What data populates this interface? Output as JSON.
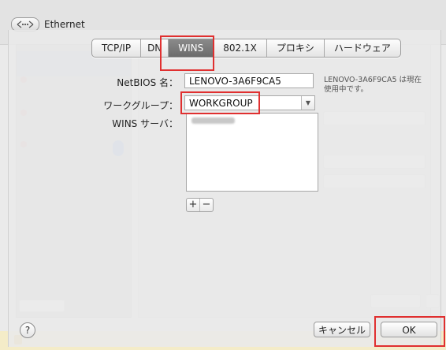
{
  "window": {
    "title": "Ethernet"
  },
  "tabs": [
    {
      "label": "TCP/IP"
    },
    {
      "label": "DN"
    },
    {
      "label": "WINS"
    },
    {
      "label": "802.1X"
    },
    {
      "label": "プロキシ"
    },
    {
      "label": "ハードウェア"
    }
  ],
  "active_tab": "WINS",
  "form": {
    "netbios_label": "NetBIOS 名：",
    "netbios_value": "LENOVO-3A6F9CA5",
    "netbios_status": "LENOVO-3A6F9CA5 は現在使用中です。",
    "workgroup_label": "ワークグループ：",
    "workgroup_value": "WORKGROUP",
    "wins_server_label": "WINS サーバ："
  },
  "wins_list": {
    "add": "+",
    "remove": "−"
  },
  "buttons": {
    "help": "?",
    "cancel": "キャンセル",
    "ok": "OK"
  },
  "colors": {
    "highlight": "#e03030",
    "active_tab": "#777777"
  }
}
